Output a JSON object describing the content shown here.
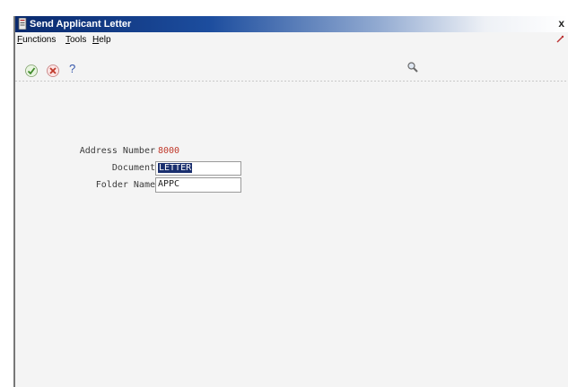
{
  "window": {
    "title": "Send Applicant Letter",
    "close_glyph": "x"
  },
  "menu": {
    "items": [
      {
        "label": "Functions"
      },
      {
        "label": "Tools"
      },
      {
        "label": "Help"
      }
    ]
  },
  "toolbar": {
    "ok_icon": "check-icon",
    "cancel_icon": "cancel-icon",
    "help_label": "?",
    "search_icon": "magnifier-icon"
  },
  "form": {
    "address_number_label": "Address Number",
    "address_number_value": "8000",
    "document_label": "Document",
    "document_value": "LETTER",
    "folder_name_label": "Folder Name",
    "folder_name_value": "APPC"
  },
  "colors": {
    "title_bar": "#0a2a6e",
    "accent_red": "#c0392b",
    "selection": "#1a2f6e"
  }
}
